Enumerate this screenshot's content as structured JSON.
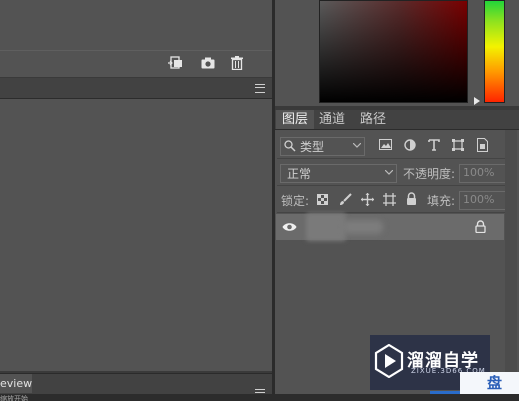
{
  "left": {
    "history_toolbar_icons": [
      "new-document-from-state-icon",
      "camera-icon",
      "trash-icon"
    ],
    "preview_tab_label": "eview",
    "bottom_hint": "缩放开始"
  },
  "color_panel": {
    "field_hue": "#7a0000",
    "hue_strip_colors": [
      "#22d53a",
      "#f3f300",
      "#ff9a00",
      "#ff2400"
    ]
  },
  "layers_panel": {
    "tabs": [
      {
        "label": "图层",
        "active": true
      },
      {
        "label": "通道",
        "active": false
      },
      {
        "label": "路径",
        "active": false
      }
    ],
    "filter": {
      "label": "类型",
      "icons": [
        "image-filter-icon",
        "adjustment-filter-icon",
        "type-filter-icon",
        "shape-filter-icon",
        "smart-object-filter-icon"
      ]
    },
    "blend_mode": "正常",
    "opacity_label": "不透明度:",
    "opacity_value": "100%",
    "lock_label": "锁定:",
    "fill_label": "填充:",
    "fill_value": "100%",
    "layer_locked": true
  },
  "watermark": {
    "title": "溜溜自学",
    "url": "ZIXUE.3D66.COM",
    "extra_char": "盘"
  }
}
